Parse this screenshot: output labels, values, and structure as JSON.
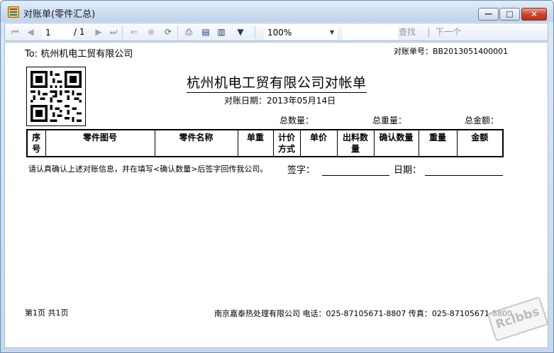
{
  "window": {
    "title": "对账单(零件汇总)",
    "min_glyph": "—",
    "max_glyph": "□",
    "close_glyph": "✕"
  },
  "toolbar": {
    "current_page": "1",
    "page_total": "/ 1",
    "zoom": "100%",
    "find_label": "查找",
    "find_next_label": "下一个",
    "icons": [
      "first-page-icon",
      "prev-page-icon",
      "next-page-icon",
      "last-page-icon",
      "back-icon",
      "stop-icon",
      "refresh-icon",
      "print-icon",
      "page-setup-icon",
      "layout-icon",
      "export-icon"
    ]
  },
  "report": {
    "to": "To: 杭州机电工贸有限公司",
    "bill_no": "对账单号：BB2013051400001",
    "title": "杭州机电工贸有限公司对帐单",
    "bill_date": "对账日期：2013年05月14日",
    "total_qty": "总数量：",
    "total_weight": "总重量：",
    "total_amount": "总金额：",
    "columns": [
      "序号",
      "零件图号",
      "零件名称",
      "单重",
      "计价方式",
      "单价",
      "出料数量",
      "确认数量",
      "重量",
      "金额"
    ],
    "notice": "请认真确认上述对账信息，并在填写<确认数量>后签字回传我公司。",
    "sign_label": "签字：",
    "date_label": "日期：",
    "page_info": "第1页  共1页",
    "footer": "南京嘉泰热处理有限公司    电话：025-87105671-8807 传真：025-87105671-8800"
  },
  "watermark": "Rclbbs"
}
